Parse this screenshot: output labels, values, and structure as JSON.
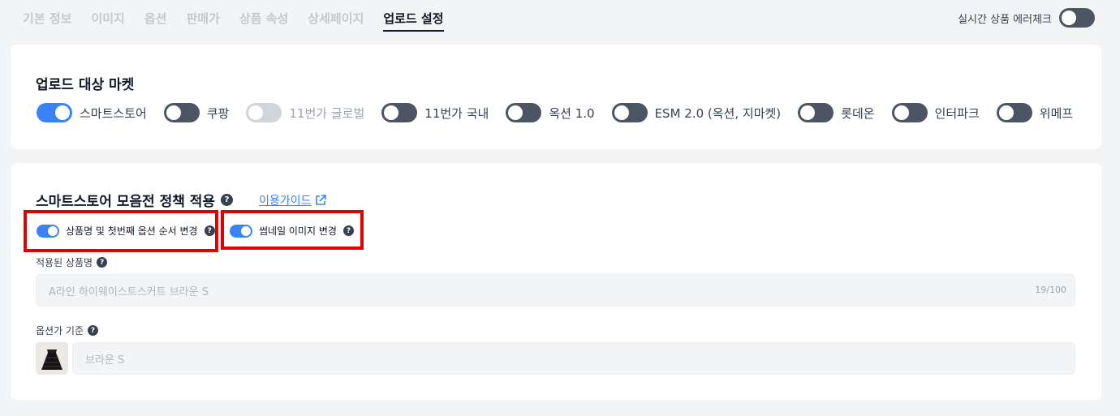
{
  "tabs": [
    "기본 정보",
    "이미지",
    "옵션",
    "판매가",
    "상품 속성",
    "상세페이지",
    "업로드 설정"
  ],
  "realtime_label": "실시간 상품 에러체크",
  "market_section": {
    "title": "업로드 대상 마켓",
    "markets": [
      {
        "label": "스마트스토어",
        "state": "on"
      },
      {
        "label": "쿠팡",
        "state": "off"
      },
      {
        "label": "11번가 글로벌",
        "state": "disabled"
      },
      {
        "label": "11번가 국내",
        "state": "off"
      },
      {
        "label": "옥션 1.0",
        "state": "off"
      },
      {
        "label": "ESM 2.0 (옥션, 지마켓)",
        "state": "off"
      },
      {
        "label": "롯데온",
        "state": "off"
      },
      {
        "label": "인터파크",
        "state": "off"
      },
      {
        "label": "위메프",
        "state": "off"
      }
    ]
  },
  "policy": {
    "title": "스마트스토어 모음전 정책 적용",
    "help_icon": "?",
    "guide_label": "이용가이드",
    "option1_label": "상품명 및 첫번째 옵션 순서 변경",
    "option2_label": "썸네일 이미지 변경",
    "applied_name_label": "적용된 상품명",
    "applied_name_value": "A라인 하이웨이스트스커트 브라운 S",
    "name_counter": "19/100",
    "option_price_label": "옵션가 기준",
    "option_value": "브라운 S"
  },
  "colors": {
    "accent": "#3b82f6",
    "highlight": "#e00000"
  }
}
